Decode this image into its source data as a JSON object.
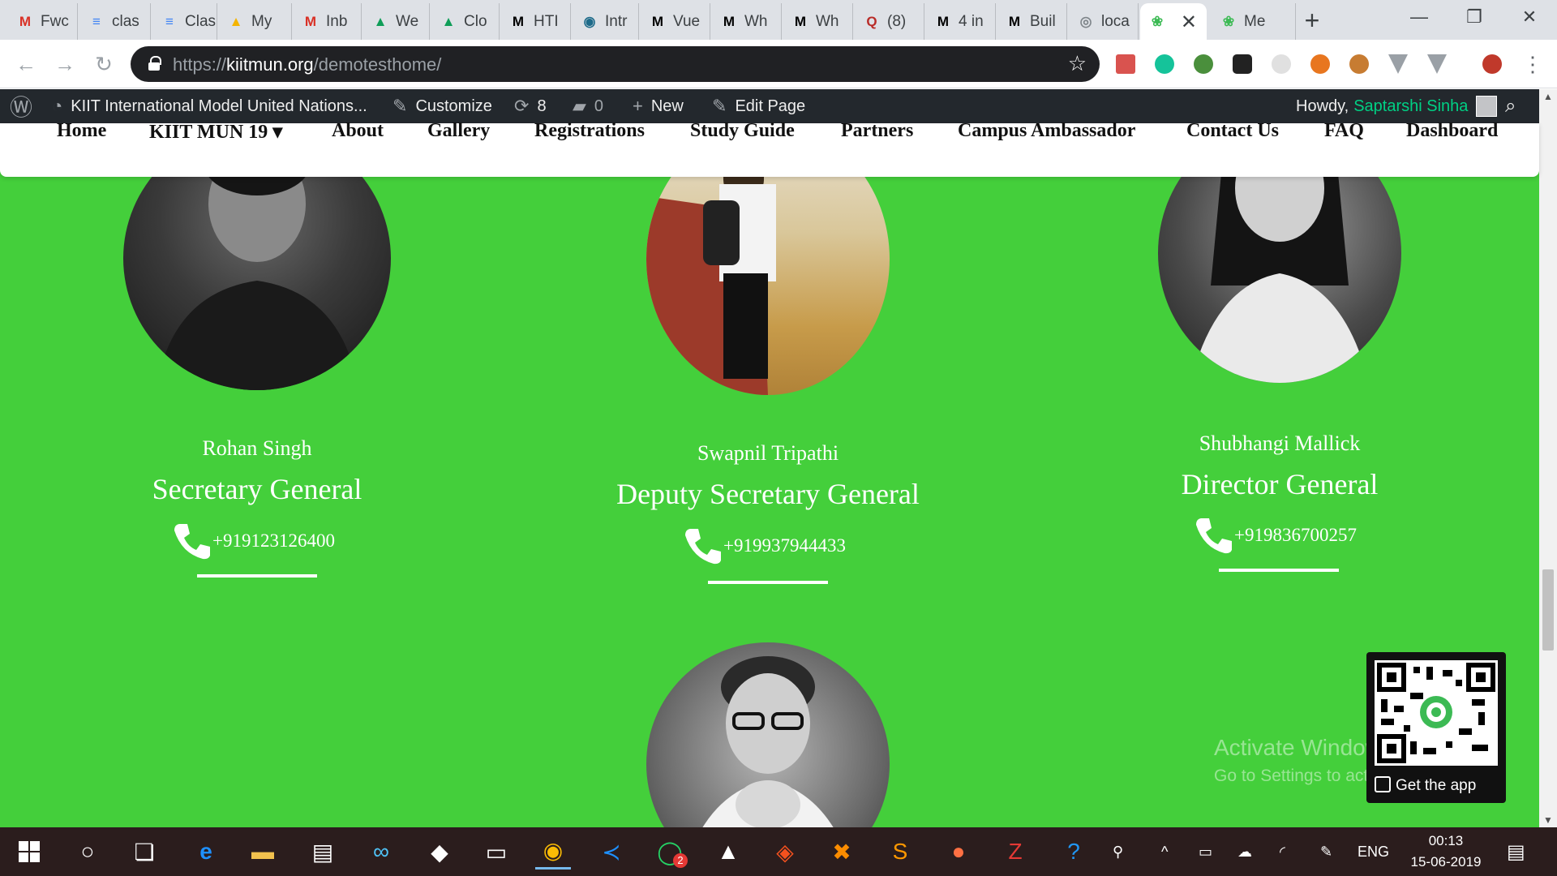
{
  "browser": {
    "tabs": [
      {
        "label": "Fwc",
        "favicon": "gmail-icon",
        "color": "#d93025",
        "glyph": "M"
      },
      {
        "label": "clas",
        "favicon": "google-docs-icon",
        "color": "#4285f4",
        "glyph": "≡"
      },
      {
        "label": "Clas",
        "favicon": "google-docs-icon",
        "color": "#4285f4",
        "glyph": "≡"
      },
      {
        "label": "My",
        "favicon": "google-drive-icon",
        "color": "#f4b400",
        "glyph": "▲"
      },
      {
        "label": "Inb",
        "favicon": "gmail-icon",
        "color": "#d93025",
        "glyph": "M"
      },
      {
        "label": "We",
        "favicon": "google-drive-icon",
        "color": "#0f9d58",
        "glyph": "▲"
      },
      {
        "label": "Clo",
        "favicon": "google-drive-icon",
        "color": "#0f9d58",
        "glyph": "▲"
      },
      {
        "label": "HTI",
        "favicon": "medium-icon",
        "color": "#000000",
        "glyph": "M"
      },
      {
        "label": "Intr",
        "favicon": "web-icon",
        "color": "#1e6b8a",
        "glyph": "◉"
      },
      {
        "label": "Vue",
        "favicon": "medium-icon",
        "color": "#000000",
        "glyph": "M"
      },
      {
        "label": "Wh",
        "favicon": "medium-icon",
        "color": "#000000",
        "glyph": "M"
      },
      {
        "label": "Wh",
        "favicon": "medium-icon",
        "color": "#000000",
        "glyph": "M"
      },
      {
        "label": "(8)",
        "favicon": "quora-icon",
        "color": "#b92b27",
        "glyph": "Q"
      },
      {
        "label": "4 in",
        "favicon": "medium-icon",
        "color": "#000000",
        "glyph": "M"
      },
      {
        "label": "Buil",
        "favicon": "medium-icon",
        "color": "#000000",
        "glyph": "M"
      },
      {
        "label": "loca",
        "favicon": "globe-icon",
        "color": "#80868b",
        "glyph": "◎"
      },
      {
        "label": "",
        "favicon": "kiitmun-logo-icon",
        "color": "#3cba54",
        "glyph": "❀",
        "active": true
      },
      {
        "label": "Me",
        "favicon": "kiitmun-logo-icon",
        "color": "#3cba54",
        "glyph": "❀"
      }
    ],
    "new_tab": "+",
    "window_controls": {
      "minimize": "—",
      "maximize": "❐",
      "close": "✕"
    },
    "url_scheme": "https://",
    "url_host": "kiitmun.org",
    "url_path": "/demotesthome/",
    "bookmark_star": "☆"
  },
  "admin_bar": {
    "wp_logo": "Ⓦ",
    "site_name": "KIIT International Model United Nations...",
    "customize": "Customize",
    "updates_count": "8",
    "comments_count": "0",
    "new": "New",
    "edit_page": "Edit Page",
    "howdy": "Howdy,",
    "user_name": "Saptarshi Sinha"
  },
  "site_nav": {
    "items": [
      "Home",
      "KIIT MUN 19",
      "About",
      "Gallery",
      "Registrations",
      "Study Guide",
      "Partners",
      "Campus Ambassador",
      "Contact Us",
      "FAQ",
      "Dashboard"
    ],
    "dropdown_caret": "▾"
  },
  "people": [
    {
      "name": "Rohan Singh",
      "role": "Secretary General",
      "phone": "+919123126400"
    },
    {
      "name": "Swapnil Tripathi",
      "role": "Deputy Secretary General",
      "phone": "+919937944433"
    },
    {
      "name": "Shubhangi Mallick",
      "role": "Director General",
      "phone": "+919836700257"
    }
  ],
  "qr_widget": {
    "label": "Get the app"
  },
  "watermark": {
    "line1": "Activate Windows",
    "line2": "Go to Settings to activate Windows."
  },
  "taskbar": {
    "language": "ENG",
    "time": "00:13",
    "date": "15-06-2019",
    "whatsapp_badge": "2"
  },
  "colors": {
    "content_bg": "#44cf3b",
    "admin_bar_bg": "#23282d",
    "admin_user": "#00d084",
    "taskbar_bg": "#2b1d1d"
  }
}
